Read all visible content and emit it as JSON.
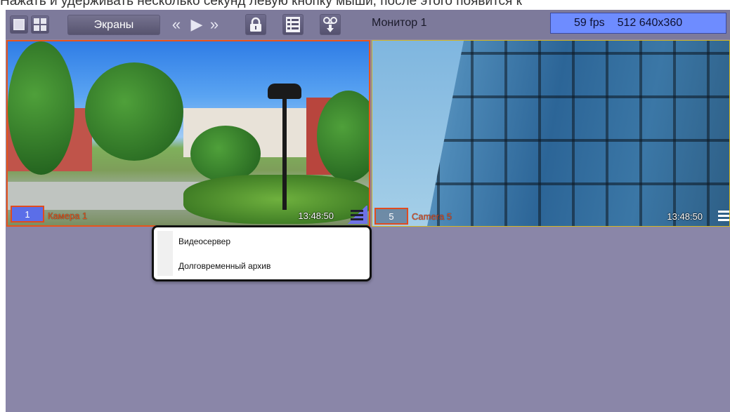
{
  "caption": "Нажать и удерживать несколько секунд левую кнопку мыши, после этого появится к",
  "toolbar": {
    "screens_label": "Экраны",
    "monitor_label": "Монитор 1",
    "fps": "59 fps",
    "resolution": "512 640x360",
    "icons": {
      "layout_single": "single-layout-icon",
      "layout_quad": "quad-layout-icon",
      "prev": "double-chevron-left-icon",
      "play": "play-icon",
      "next": "double-chevron-right-icon",
      "lock": "lock-icon",
      "list": "list-icon",
      "tape": "tape-icon"
    }
  },
  "tiles": [
    {
      "number": "1",
      "name": "Камера 1",
      "time": "13:48:50"
    },
    {
      "number": "5",
      "name": "Camera 5",
      "time": "13:48:50"
    }
  ],
  "context_menu": {
    "items": [
      "Видеосервер",
      "Долговременный архив"
    ]
  },
  "colors": {
    "app_bg": "#8a86a8",
    "active_border": "#e8541c",
    "fps_bg": "#6e8cff"
  }
}
